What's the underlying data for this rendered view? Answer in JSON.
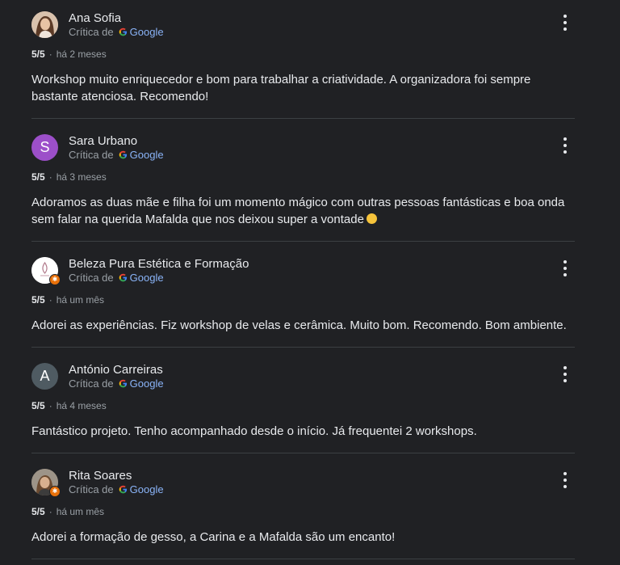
{
  "reviews": [
    {
      "name": "Ana Sofia",
      "source_prefix": "Crítica de",
      "source": "Google",
      "rating": "5/5",
      "time": "há 2 meses",
      "text": "Workshop muito enriquecedor e bom para trabalhar a criatividade. A organizadora foi sempre bastante atenciosa. Recomendo!",
      "avatar": "photo-avatar"
    },
    {
      "name": "Sara Urbano",
      "source_prefix": "Crítica de",
      "source": "Google",
      "rating": "5/5",
      "time": "há 3 meses",
      "text": "Adoramos as duas mãe e filha foi um momento mágico com outras pessoas fantásticas e boa onda sem falar na querida Mafalda que nos deixou super a vontade",
      "avatar_letter": "S",
      "avatar_color": "#9c4fc9"
    },
    {
      "name": "Beleza Pura Estética e Formação",
      "source_prefix": "Crítica de",
      "source": "Google",
      "rating": "5/5",
      "time": "há um mês",
      "text": "Adorei as experiências. Fiz workshop de velas e cerâmica. Muito bom. Recomendo. Bom ambiente.",
      "avatar": "logo-avatar"
    },
    {
      "name": "António Carreiras",
      "source_prefix": "Crítica de",
      "source": "Google",
      "rating": "5/5",
      "time": "há 4 meses",
      "text": "Fantástico projeto. Tenho acompanhado desde o início. Já frequentei 2 workshops.",
      "avatar_letter": "A",
      "avatar_color": "#4f5b62"
    },
    {
      "name": "Rita Soares",
      "source_prefix": "Crítica de",
      "source": "Google",
      "rating": "5/5",
      "time": "há um mês",
      "text": "Adorei a formação de gesso, a Carina e a Mafalda são um encanto!",
      "avatar": "photo-avatar"
    }
  ],
  "colors": {
    "background": "#202124",
    "text": "#e8eaed",
    "secondary": "#9aa0a6",
    "link": "#8ab4f8",
    "divider": "#3c4043",
    "local_guide_badge": "#e8710a"
  }
}
